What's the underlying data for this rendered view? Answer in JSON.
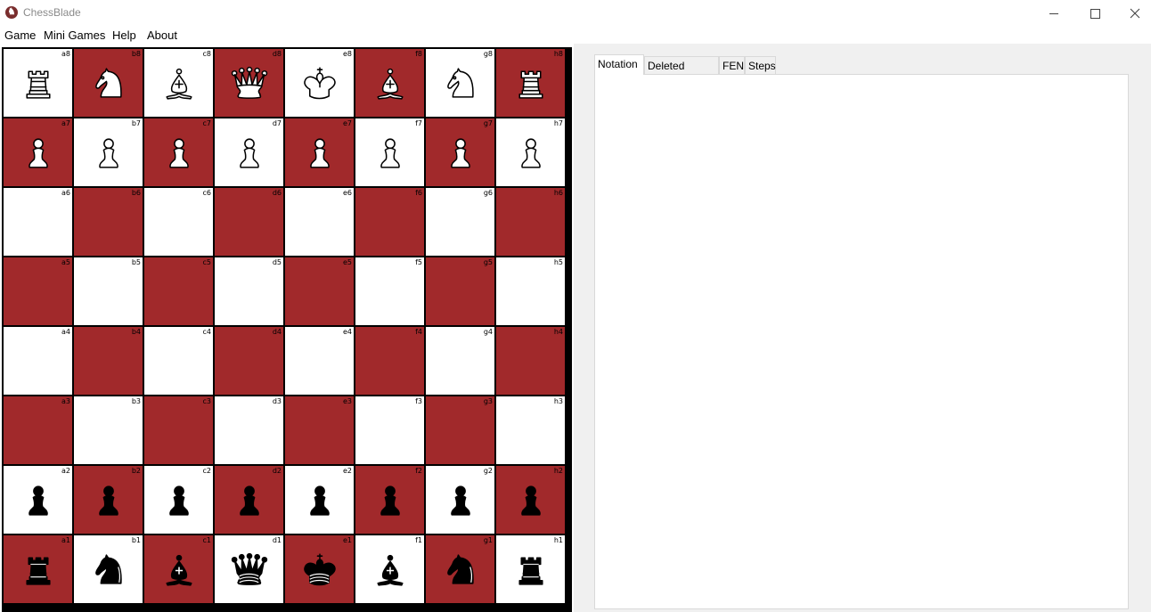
{
  "window": {
    "title": "ChessBlade",
    "icon": "app-logo-icon"
  },
  "menu": [
    "Game",
    "Mini Games",
    "Help",
    "About"
  ],
  "colors": {
    "light_square": "#ffffff",
    "dark_square": "#a1292b",
    "border": "#000000"
  },
  "board": {
    "files": [
      "a",
      "b",
      "c",
      "d",
      "e",
      "f",
      "g",
      "h"
    ],
    "ranks": [
      8,
      7,
      6,
      5,
      4,
      3,
      2,
      1
    ],
    "pieces": {
      "a8": "white-rook",
      "b8": "white-knight",
      "c8": "white-bishop",
      "d8": "white-queen",
      "e8": "white-king",
      "f8": "white-bishop",
      "g8": "white-knight",
      "h8": "white-rook",
      "a7": "white-pawn",
      "b7": "white-pawn",
      "c7": "white-pawn",
      "d7": "white-pawn",
      "e7": "white-pawn",
      "f7": "white-pawn",
      "g7": "white-pawn",
      "h7": "white-pawn",
      "a2": "black-pawn",
      "b2": "black-pawn",
      "c2": "black-pawn",
      "d2": "black-pawn",
      "e2": "black-pawn",
      "f2": "black-pawn",
      "g2": "black-pawn",
      "h2": "black-pawn",
      "a1": "black-rook",
      "b1": "black-knight",
      "c1": "black-bishop",
      "d1": "black-queen",
      "e1": "black-king",
      "f1": "black-bishop",
      "g1": "black-knight",
      "h1": "black-rook"
    }
  },
  "tabs": [
    {
      "label": "Notation",
      "active": true
    },
    {
      "label": "Deleted pieces",
      "active": false
    },
    {
      "label": "FEN",
      "active": false
    },
    {
      "label": "Steps",
      "active": false
    }
  ]
}
